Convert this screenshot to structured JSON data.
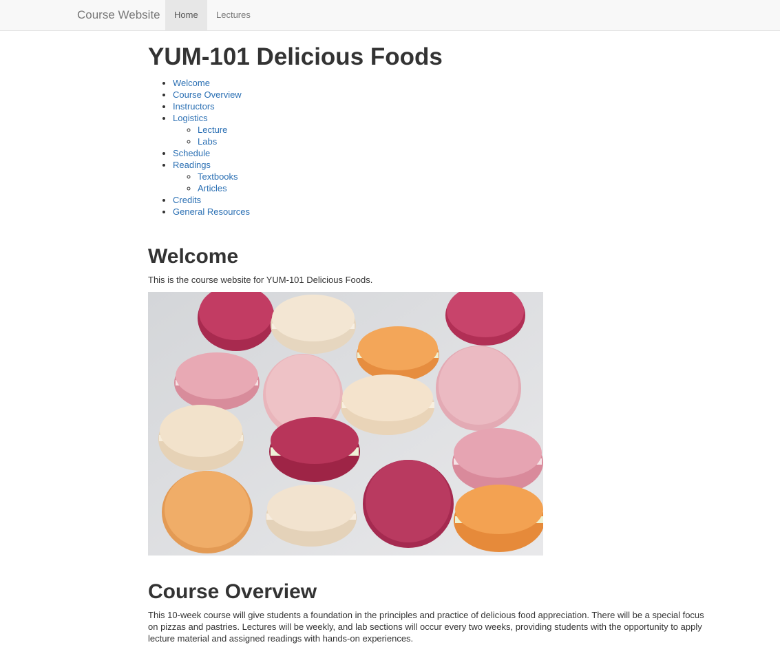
{
  "navbar": {
    "brand": "Course Website",
    "tabs": [
      {
        "label": "Home",
        "active": true
      },
      {
        "label": "Lectures",
        "active": false
      }
    ]
  },
  "page": {
    "title": "YUM-101 Delicious Foods"
  },
  "toc": {
    "welcome": "Welcome",
    "course_overview": "Course Overview",
    "instructors": "Instructors",
    "logistics": "Logistics",
    "lecture": "Lecture",
    "labs": "Labs",
    "schedule": "Schedule",
    "readings": "Readings",
    "textbooks": "Textbooks",
    "articles": "Articles",
    "credits": "Credits",
    "general_resources": "General Resources"
  },
  "welcome": {
    "heading": "Welcome",
    "text": "This is the course website for YUM-101 Delicious Foods."
  },
  "overview": {
    "heading": "Course Overview",
    "text": "This 10-week course will give students a foundation in the principles and practice of delicious food appreciation. There will be a special focus on pizzas and pastries. Lectures will be weekly, and lab sections will occur every two weeks, providing students with the opportunity to apply lecture material and assigned readings with hands-on experiences."
  },
  "colors": {
    "link": "#2a6fb3",
    "navbar_bg": "#f8f8f8",
    "active_tab_bg": "#e7e7e7",
    "macaron_magenta": "#b5345a",
    "macaron_pink": "#e3a6b1",
    "macaron_cream": "#f1e4d3",
    "macaron_orange": "#f0a55a",
    "photo_bg": "#dcdde0"
  }
}
